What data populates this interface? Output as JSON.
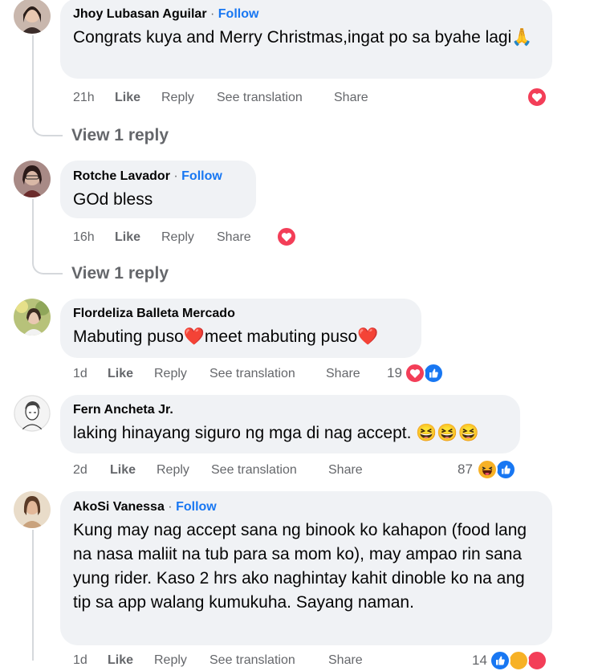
{
  "comments": [
    {
      "author": "Jhoy Lubasan Aguilar",
      "follow": "Follow",
      "text": "Congrats kuya and Merry Christmas,ingat po sa byahe lagi🙏",
      "time": "21h",
      "like": "Like",
      "reply": "Reply",
      "translation": "See translation",
      "share": "Share",
      "reactions": [
        "love"
      ],
      "view_replies": "View 1 reply"
    },
    {
      "author": "Rotche Lavador",
      "follow": "Follow",
      "text": "GOd bless",
      "time": "16h",
      "like": "Like",
      "reply": "Reply",
      "share": "Share",
      "reactions": [
        "love"
      ],
      "view_replies": "View 1 reply"
    },
    {
      "author": "Flordeliza Balleta Mercado",
      "text": "Mabuting puso❤️meet mabuting puso❤️",
      "time": "1d",
      "like": "Like",
      "reply": "Reply",
      "translation": "See translation",
      "share": "Share",
      "reaction_count": "19",
      "reactions": [
        "love",
        "like"
      ]
    },
    {
      "author": "Fern Ancheta Jr.",
      "text": "laking hinayang siguro ng mga di nag accept. 😆😆😆",
      "time": "2d",
      "like": "Like",
      "reply": "Reply",
      "translation": "See translation",
      "share": "Share",
      "reaction_count": "87",
      "reactions": [
        "haha",
        "like"
      ]
    },
    {
      "author": "AkoSi Vanessa",
      "follow": "Follow",
      "text": "Kung may nag accept sana ng binook ko kahapon (food lang na nasa maliit na tub para sa mom ko), may ampao rin sana yung rider. Kaso 2 hrs ako naghintay kahit dinoble ko na ang tip sa app walang kumukuha. Sayang naman.",
      "time": "1d",
      "like": "Like",
      "reply": "Reply",
      "translation": "See translation",
      "share": "Share",
      "reaction_count": "14",
      "reactions": [
        "like",
        "haha",
        "love"
      ]
    }
  ],
  "colors": {
    "bubble": "#f0f2f5",
    "follow": "#1877f2",
    "meta": "#65676b",
    "love": "#f33e58",
    "like": "#1877f2",
    "haha": "#f7b125"
  }
}
